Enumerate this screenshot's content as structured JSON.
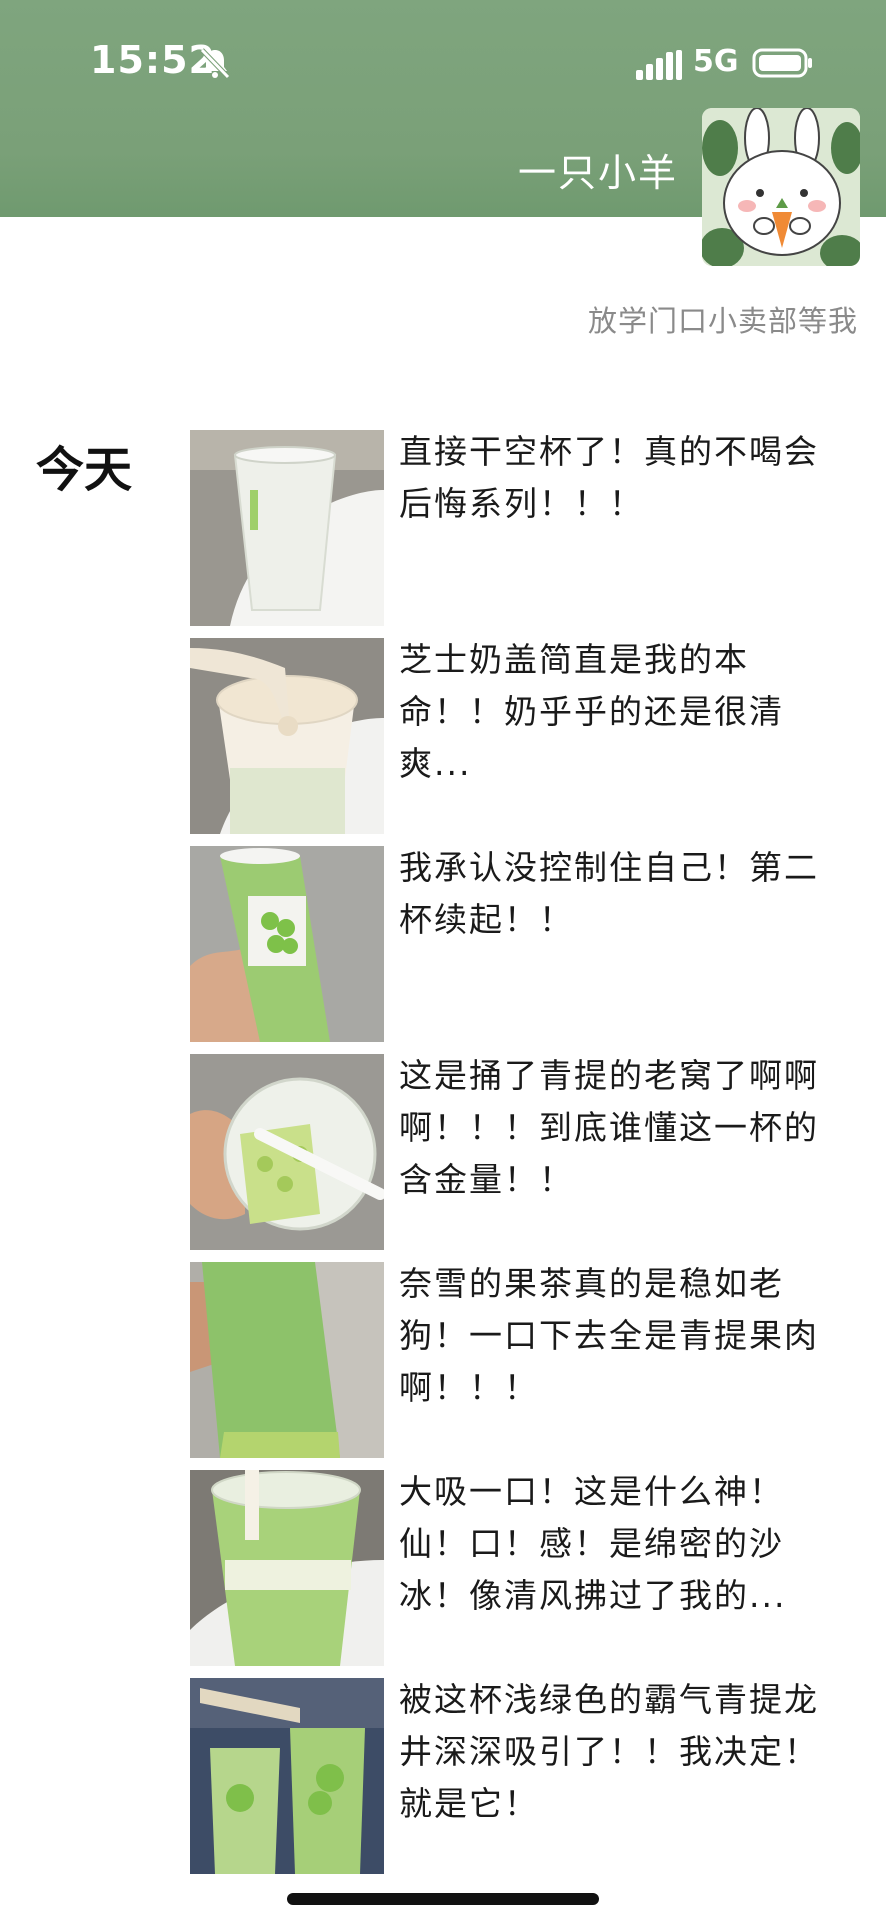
{
  "status_bar": {
    "time": "15:52",
    "network": "5G"
  },
  "profile": {
    "username": "一只小羊",
    "signature": "放学门口小卖部等我"
  },
  "feed": {
    "day_label": "今天",
    "posts": [
      {
        "text": "直接干空杯了！真的不喝会后悔系列！！！"
      },
      {
        "text": "芝士奶盖简直是我的本命！！奶乎乎的还是很清爽..."
      },
      {
        "text": "我承认没控制住自己！第二杯续起！！"
      },
      {
        "text": "这是捅了青提的老窝了啊啊啊！！！到底谁懂这一杯的含金量！！"
      },
      {
        "text": "奈雪的果茶真的是稳如老狗！一口下去全是青提果肉啊！！！"
      },
      {
        "text": "大吸一口！这是什么神！仙！口！感！是绵密的沙冰！像清风拂过了我的..."
      },
      {
        "text": "被这杯浅绿色的霸气青提龙井深深吸引了！！我决定！就是它！"
      }
    ]
  },
  "colors": {
    "header": "#7aa078",
    "signature": "#8a8a8a"
  }
}
